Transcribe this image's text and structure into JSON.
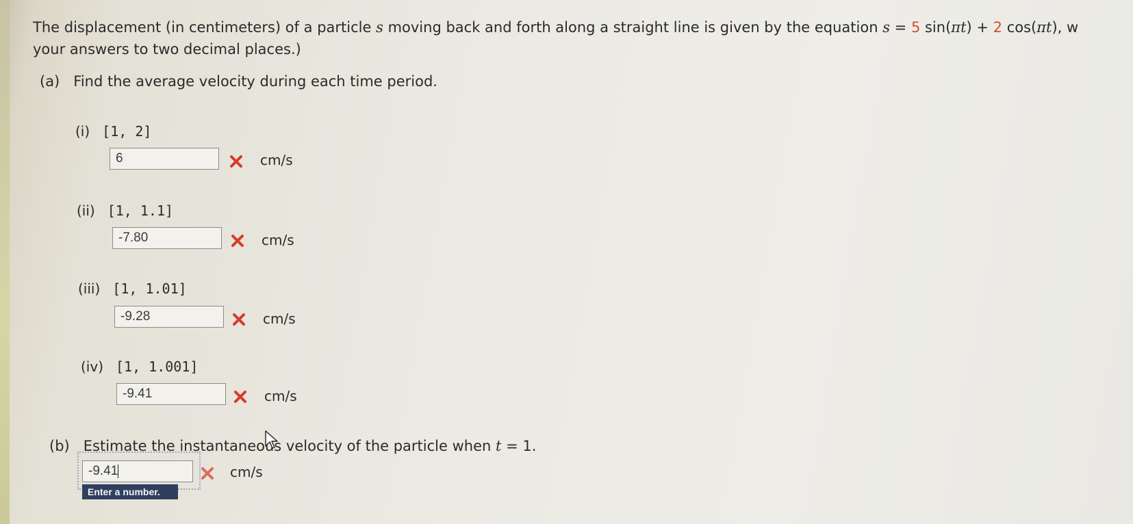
{
  "problem": {
    "line1_prefix": "The displacement (in centimeters) of a particle ",
    "var_s": "s",
    "line1_mid": " moving back and forth along a straight line is given by the equation ",
    "eq_lhs": "s",
    "eq_equals": " = ",
    "coef1": "5",
    "sin_part": " sin(",
    "pi_t_1": "πt",
    "sin_close": ") + ",
    "coef2": "2",
    "cos_part": " cos(",
    "pi_t_2": "πt",
    "cos_close": "), w",
    "line2": "your answers to two decimal places.)"
  },
  "part_a": {
    "label": "(a)",
    "prompt": "Find the average velocity during each time period.",
    "items": [
      {
        "label": "(i)",
        "interval": "[1, 2]",
        "answer": "6",
        "unit": "cm/s",
        "status": "incorrect"
      },
      {
        "label": "(ii)",
        "interval": "[1, 1.1]",
        "answer": "-7.80",
        "unit": "cm/s",
        "status": "incorrect"
      },
      {
        "label": "(iii)",
        "interval": "[1, 1.01]",
        "answer": "-9.28",
        "unit": "cm/s",
        "status": "incorrect"
      },
      {
        "label": "(iv)",
        "interval": "[1, 1.001]",
        "answer": "-9.41",
        "unit": "cm/s",
        "status": "incorrect"
      }
    ]
  },
  "part_b": {
    "label": "(b)",
    "prompt_pre": "Estimate the instantaneous velocity of the particle when ",
    "var_t": "t",
    "prompt_post": " = 1.",
    "answer": "-9.41",
    "unit": "cm/s",
    "status": "incorrect",
    "hint": "Enter a number."
  },
  "colors": {
    "incorrect_mark": "#d63a2a",
    "number_highlight": "#d1512d",
    "hint_bg": "#2f3f5f"
  }
}
